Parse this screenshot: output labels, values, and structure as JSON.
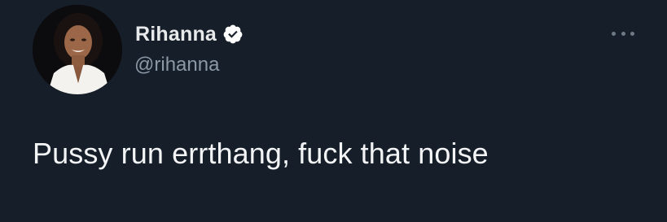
{
  "tweet": {
    "author": {
      "display_name": "Rihanna",
      "handle": "@rihanna",
      "verified": true,
      "avatar": "profile-photo"
    },
    "text": "Pussy run errthang, fuck that noise",
    "more_menu_icon": "more-horizontal-icon"
  },
  "colors": {
    "background": "#161e29",
    "primary_text": "#e7e9ea",
    "secondary_text": "#8b98a5",
    "verified_badge": "#ffffff"
  }
}
